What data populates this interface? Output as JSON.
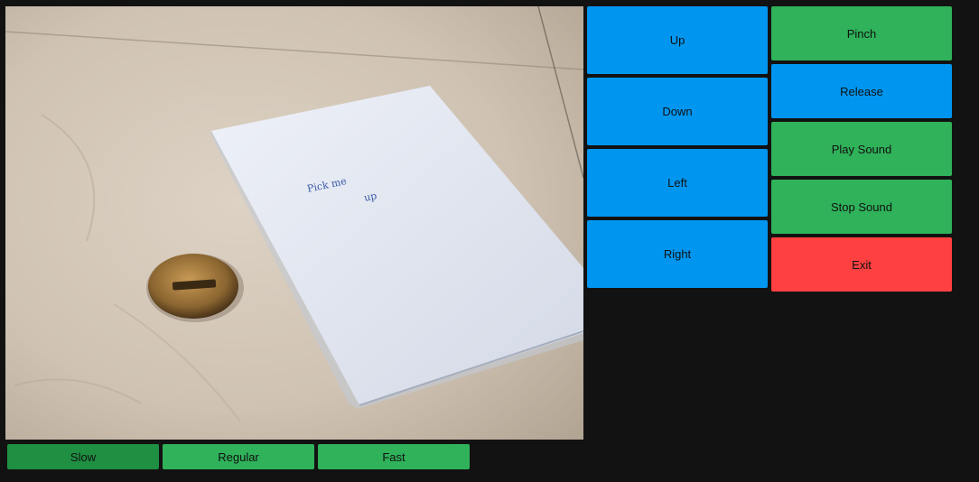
{
  "camera": {
    "handwritten_note": [
      "Pick me",
      "up"
    ]
  },
  "movement": {
    "up": "Up",
    "down": "Down",
    "left": "Left",
    "right": "Right"
  },
  "actions": {
    "pinch": "Pinch",
    "release": "Release",
    "play_sound": "Play Sound",
    "stop_sound": "Stop Sound",
    "exit": "Exit"
  },
  "speed": {
    "options": [
      "Slow",
      "Regular",
      "Fast"
    ],
    "selected": "Slow"
  },
  "colors": {
    "background": "#121212",
    "blue_button": "#0096f0",
    "green_button": "#2fb25a",
    "green_selected": "#1f8f41",
    "red_button": "#ff4040"
  }
}
